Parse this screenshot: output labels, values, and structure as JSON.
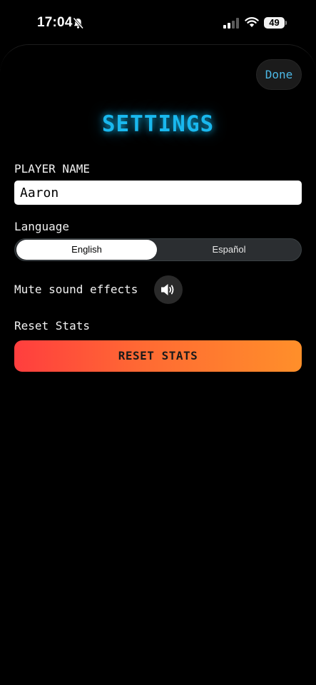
{
  "status_bar": {
    "time": "17:04",
    "battery": "49",
    "icons": [
      "bell-slash-icon",
      "cellular-signal-icon",
      "wifi-icon",
      "battery-icon"
    ]
  },
  "header": {
    "done_label": "Done",
    "title": "SETTINGS"
  },
  "player_name": {
    "label": "PLAYER NAME",
    "value": "Aaron"
  },
  "language": {
    "label": "Language",
    "options": [
      "English",
      "Español"
    ],
    "selected": "English"
  },
  "mute": {
    "label": "Mute sound effects",
    "icon": "speaker-on-icon",
    "muted": false
  },
  "reset": {
    "label": "Reset Stats",
    "button_label": "RESET STATS"
  },
  "colors": {
    "accent": "#19b8ee",
    "done_text": "#4cb8e6",
    "reset_gradient_start": "#ff3e3e",
    "reset_gradient_end": "#ff8f2a",
    "background": "#000000"
  }
}
